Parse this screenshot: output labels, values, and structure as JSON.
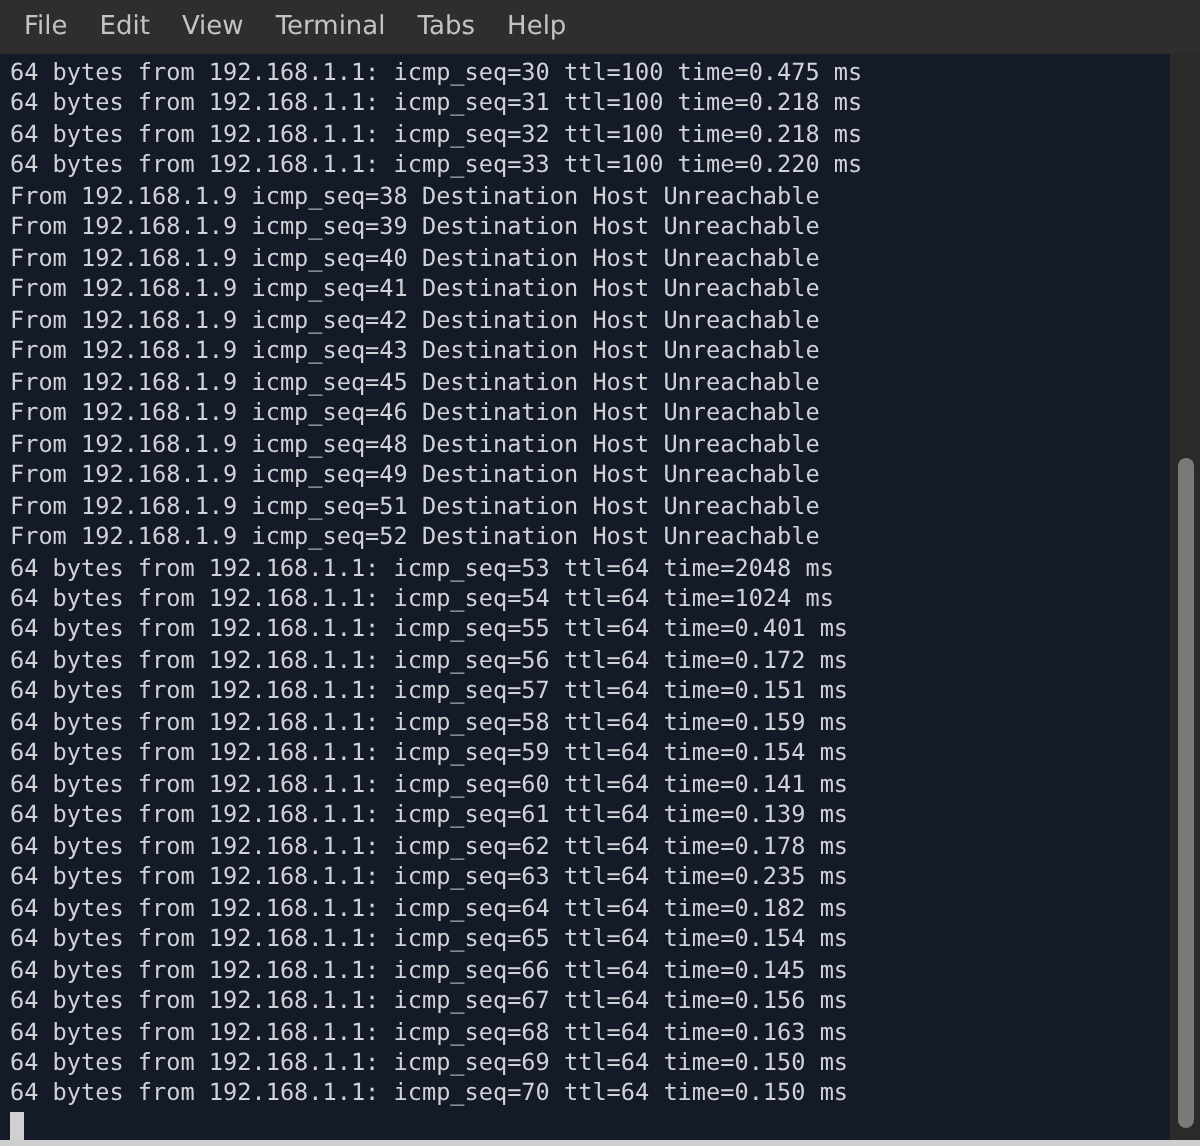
{
  "menu": [
    "File",
    "Edit",
    "View",
    "Terminal",
    "Tabs",
    "Help"
  ],
  "lines": [
    "64 bytes from 192.168.1.1: icmp_seq=30 ttl=100 time=0.475 ms",
    "64 bytes from 192.168.1.1: icmp_seq=31 ttl=100 time=0.218 ms",
    "64 bytes from 192.168.1.1: icmp_seq=32 ttl=100 time=0.218 ms",
    "64 bytes from 192.168.1.1: icmp_seq=33 ttl=100 time=0.220 ms",
    "From 192.168.1.9 icmp_seq=38 Destination Host Unreachable",
    "From 192.168.1.9 icmp_seq=39 Destination Host Unreachable",
    "From 192.168.1.9 icmp_seq=40 Destination Host Unreachable",
    "From 192.168.1.9 icmp_seq=41 Destination Host Unreachable",
    "From 192.168.1.9 icmp_seq=42 Destination Host Unreachable",
    "From 192.168.1.9 icmp_seq=43 Destination Host Unreachable",
    "From 192.168.1.9 icmp_seq=45 Destination Host Unreachable",
    "From 192.168.1.9 icmp_seq=46 Destination Host Unreachable",
    "From 192.168.1.9 icmp_seq=48 Destination Host Unreachable",
    "From 192.168.1.9 icmp_seq=49 Destination Host Unreachable",
    "From 192.168.1.9 icmp_seq=51 Destination Host Unreachable",
    "From 192.168.1.9 icmp_seq=52 Destination Host Unreachable",
    "64 bytes from 192.168.1.1: icmp_seq=53 ttl=64 time=2048 ms",
    "64 bytes from 192.168.1.1: icmp_seq=54 ttl=64 time=1024 ms",
    "64 bytes from 192.168.1.1: icmp_seq=55 ttl=64 time=0.401 ms",
    "64 bytes from 192.168.1.1: icmp_seq=56 ttl=64 time=0.172 ms",
    "64 bytes from 192.168.1.1: icmp_seq=57 ttl=64 time=0.151 ms",
    "64 bytes from 192.168.1.1: icmp_seq=58 ttl=64 time=0.159 ms",
    "64 bytes from 192.168.1.1: icmp_seq=59 ttl=64 time=0.154 ms",
    "64 bytes from 192.168.1.1: icmp_seq=60 ttl=64 time=0.141 ms",
    "64 bytes from 192.168.1.1: icmp_seq=61 ttl=64 time=0.139 ms",
    "64 bytes from 192.168.1.1: icmp_seq=62 ttl=64 time=0.178 ms",
    "64 bytes from 192.168.1.1: icmp_seq=63 ttl=64 time=0.235 ms",
    "64 bytes from 192.168.1.1: icmp_seq=64 ttl=64 time=0.182 ms",
    "64 bytes from 192.168.1.1: icmp_seq=65 ttl=64 time=0.154 ms",
    "64 bytes from 192.168.1.1: icmp_seq=66 ttl=64 time=0.145 ms",
    "64 bytes from 192.168.1.1: icmp_seq=67 ttl=64 time=0.156 ms",
    "64 bytes from 192.168.1.1: icmp_seq=68 ttl=64 time=0.163 ms",
    "64 bytes from 192.168.1.1: icmp_seq=69 ttl=64 time=0.150 ms",
    "64 bytes from 192.168.1.1: icmp_seq=70 ttl=64 time=0.150 ms"
  ]
}
